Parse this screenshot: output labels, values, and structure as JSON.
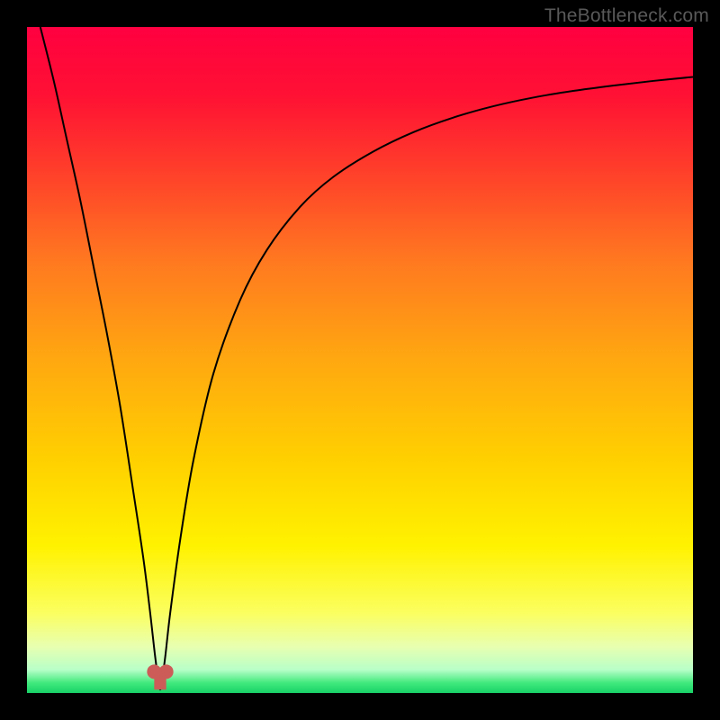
{
  "watermark": "TheBottleneck.com",
  "colors": {
    "frame": "#000000",
    "text": "#595959",
    "curve": "#000000",
    "marker_fill": "#cc5c58",
    "marker_stroke": "#cc5c58",
    "gradient_stops": [
      {
        "offset": 0.0,
        "color": "#ff0040"
      },
      {
        "offset": 0.1,
        "color": "#ff1034"
      },
      {
        "offset": 0.22,
        "color": "#ff402a"
      },
      {
        "offset": 0.35,
        "color": "#ff7820"
      },
      {
        "offset": 0.5,
        "color": "#ffa810"
      },
      {
        "offset": 0.65,
        "color": "#ffd000"
      },
      {
        "offset": 0.78,
        "color": "#fff200"
      },
      {
        "offset": 0.88,
        "color": "#fbff60"
      },
      {
        "offset": 0.93,
        "color": "#e8ffb0"
      },
      {
        "offset": 0.965,
        "color": "#b8ffc8"
      },
      {
        "offset": 0.985,
        "color": "#40e97c"
      },
      {
        "offset": 1.0,
        "color": "#18d268"
      }
    ]
  },
  "chart_data": {
    "type": "line",
    "title": "",
    "xlabel": "",
    "ylabel": "",
    "xlim": [
      0,
      100
    ],
    "ylim": [
      0,
      100
    ],
    "xmin_at_optimum_pct": 20,
    "series": [
      {
        "name": "bottleneck-curve",
        "x": [
          2,
          4,
          6,
          8,
          10,
          12,
          14,
          16,
          17.5,
          18.5,
          19.3,
          20,
          20.7,
          21.5,
          23,
          25,
          28,
          32,
          36,
          41,
          46,
          52,
          58,
          64,
          70,
          76,
          82,
          88,
          94,
          100
        ],
        "y": [
          100,
          92,
          83,
          74,
          64,
          54,
          43,
          30,
          20,
          12,
          5,
          0.5,
          5,
          12,
          23,
          35,
          48,
          59,
          66.5,
          73,
          77.5,
          81.3,
          84.2,
          86.4,
          88.1,
          89.4,
          90.4,
          91.2,
          91.9,
          92.5
        ]
      }
    ],
    "markers": [
      {
        "name": "min-marker-left",
        "x": 19.1,
        "y": 3.2
      },
      {
        "name": "min-marker-right",
        "x": 20.9,
        "y": 3.2
      }
    ],
    "min_bar": {
      "x": 20,
      "bottom": 0.5,
      "top": 3.2,
      "width_pct": 1.8
    }
  }
}
